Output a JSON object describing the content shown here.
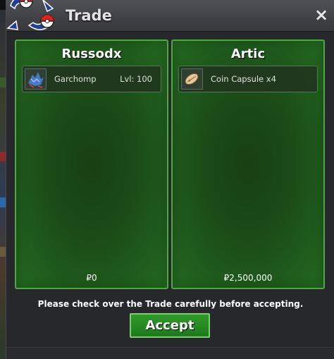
{
  "window": {
    "title": "Trade",
    "close_label": "×"
  },
  "panels": [
    {
      "player": "Russodx",
      "items": [
        {
          "icon": "garchomp-sprite-icon",
          "name": "Garchomp",
          "level": "Lvl: 100"
        }
      ],
      "money": "₽0"
    },
    {
      "player": "Artic",
      "items": [
        {
          "icon": "coin-capsule-icon",
          "name": "Coin Capsule  x4",
          "level": ""
        }
      ],
      "money": "₽2,500,000"
    }
  ],
  "footer": {
    "notice": "Please check over the Trade carefully before accepting.",
    "accept_label": "Accept"
  },
  "colors": {
    "panel_border": "#4ea645",
    "accept_button": "#2f9a2a"
  }
}
